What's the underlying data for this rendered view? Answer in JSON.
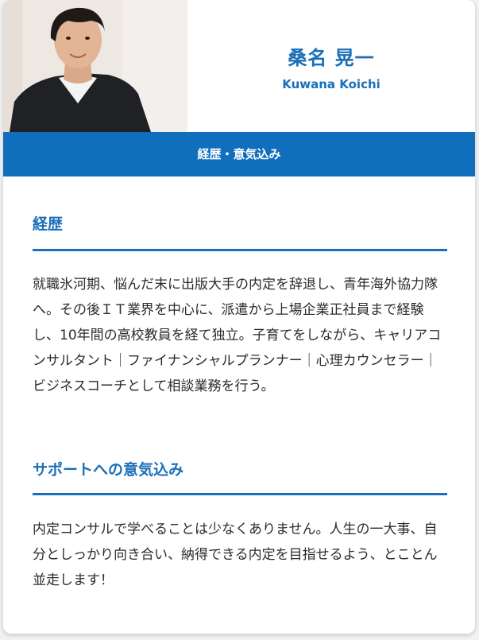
{
  "profile": {
    "name_jp": "桑名 晃一",
    "name_en": "Kuwana Koichi"
  },
  "banner": {
    "label": "経歴・意気込み"
  },
  "sections": [
    {
      "title": "経歴",
      "body": "就職氷河期、悩んだ末に出版大手の内定を辞退し、青年海外協力隊へ。その後ＩＴ業界を中心に、派遣から上場企業正社員まで経験し、10年間の高校教員を経て独立。子育てをしながら、キャリアコンサルタント｜ファイナンシャルプランナー｜心理カウンセラー｜ビジネスコーチとして相談業務を行う。"
    },
    {
      "title": "サポートへの意気込み",
      "body": "内定コンサルで学べることは少なくありません。人生の一大事、自分としっかり向き合い、納得できる内定を目指せるよう、とことん並走します！"
    }
  ],
  "colors": {
    "accent": "#1a6fb8",
    "banner": "#0f6fbd",
    "text": "#2b2b2b"
  }
}
